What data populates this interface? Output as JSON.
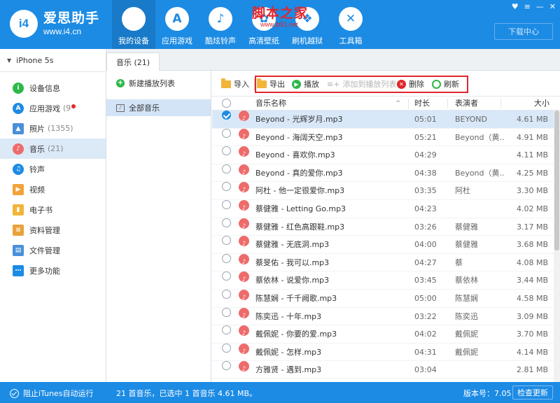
{
  "app": {
    "name": "爱思助手",
    "url": "www.i4.cn",
    "logo_text": "i4"
  },
  "watermark": {
    "text": "脚本之家",
    "url": "www.jb51.net"
  },
  "nav": [
    {
      "label": "我的设备",
      "icon": "apple-icon",
      "glyph": ""
    },
    {
      "label": "应用游戏",
      "icon": "app-store-icon",
      "glyph": "A"
    },
    {
      "label": "酷炫铃声",
      "icon": "bell-icon",
      "glyph": "♪"
    },
    {
      "label": "高清壁纸",
      "icon": "wallpaper-icon",
      "glyph": "✿"
    },
    {
      "label": "刷机越狱",
      "icon": "dropbox-icon",
      "glyph": "❖"
    },
    {
      "label": "工具箱",
      "icon": "tools-icon",
      "glyph": "✕"
    }
  ],
  "window_controls": [
    "♥",
    "≡",
    "—",
    "✕"
  ],
  "download_center": "下载中心",
  "device": {
    "name": "iPhone 5s"
  },
  "sidebar": [
    {
      "label": "设备信息",
      "count": "",
      "icon": "info-icon",
      "color": "#2db84a",
      "glyph": "i"
    },
    {
      "label": "应用游戏",
      "count": "(9",
      "icon": "app-icon",
      "color": "#1c8be4",
      "glyph": "A",
      "dot": true
    },
    {
      "label": "照片",
      "count": "(1355)",
      "icon": "photo-icon",
      "color": "#4a90d9",
      "glyph": "▲"
    },
    {
      "label": "音乐",
      "count": "(21)",
      "icon": "music-icon",
      "color": "#ee6b6b",
      "glyph": "♪"
    },
    {
      "label": "铃声",
      "count": "",
      "icon": "bell-icon",
      "color": "#1c8be4",
      "glyph": "♫"
    },
    {
      "label": "视频",
      "count": "",
      "icon": "video-icon",
      "color": "#f2a33a",
      "glyph": "▶"
    },
    {
      "label": "电子书",
      "count": "",
      "icon": "book-icon",
      "color": "#f2b53a",
      "glyph": "▮"
    },
    {
      "label": "资料管理",
      "count": "",
      "icon": "contacts-icon",
      "color": "#e8a33a",
      "glyph": "≡"
    },
    {
      "label": "文件管理",
      "count": "",
      "icon": "file-icon",
      "color": "#4a90d9",
      "glyph": "▤"
    },
    {
      "label": "更多功能",
      "count": "",
      "icon": "more-icon",
      "color": "#1c8be4",
      "glyph": "⋯"
    }
  ],
  "tab": {
    "label": "音乐 (21)"
  },
  "playlists": {
    "new_label": "新建播放列表",
    "items": [
      {
        "label": "全部音乐"
      }
    ]
  },
  "toolbar": {
    "import": "导入",
    "export": "导出",
    "play": "播放",
    "add_to_playlist": "添加到播放列表",
    "delete": "删除",
    "refresh": "刷新"
  },
  "table": {
    "columns": {
      "name": "音乐名称",
      "duration": "时长",
      "artist": "表演者",
      "size": "大小"
    },
    "rows": [
      {
        "name": "Beyond - 光辉岁月.mp3",
        "duration": "05:01",
        "artist": "BEYOND",
        "size": "4.61 MB",
        "checked": true
      },
      {
        "name": "Beyond - 海阔天空.mp3",
        "duration": "05:21",
        "artist": "Beyond（黄...",
        "size": "4.91 MB",
        "checked": false
      },
      {
        "name": "Beyond - 喜欢你.mp3",
        "duration": "04:29",
        "artist": "",
        "size": "4.11 MB",
        "checked": false
      },
      {
        "name": "Beyond - 真的爱你.mp3",
        "duration": "04:38",
        "artist": "Beyond（黄...",
        "size": "4.25 MB",
        "checked": false
      },
      {
        "name": "阿杜 - 他一定很爱你.mp3",
        "duration": "03:35",
        "artist": "阿杜",
        "size": "3.30 MB",
        "checked": false
      },
      {
        "name": "蔡健雅 - Letting Go.mp3",
        "duration": "04:23",
        "artist": "",
        "size": "4.02 MB",
        "checked": false
      },
      {
        "name": "蔡健雅 - 红色高跟鞋.mp3",
        "duration": "03:26",
        "artist": "蔡健雅",
        "size": "3.17 MB",
        "checked": false
      },
      {
        "name": "蔡健雅 - 无底洞.mp3",
        "duration": "04:00",
        "artist": "蔡健雅",
        "size": "3.68 MB",
        "checked": false
      },
      {
        "name": "蔡旻佑 - 我可以.mp3",
        "duration": "04:27",
        "artist": "蔡",
        "size": "4.08 MB",
        "checked": false
      },
      {
        "name": "蔡依林 - 说爱你.mp3",
        "duration": "03:45",
        "artist": "蔡依林",
        "size": "3.44 MB",
        "checked": false
      },
      {
        "name": "陈慧娴 - 千千阙歌.mp3",
        "duration": "05:00",
        "artist": "陈慧娴",
        "size": "4.58 MB",
        "checked": false
      },
      {
        "name": "陈奕迅 - 十年.mp3",
        "duration": "03:22",
        "artist": "陈奕迅",
        "size": "3.09 MB",
        "checked": false
      },
      {
        "name": "戴佩妮 - 你要的爱.mp3",
        "duration": "04:02",
        "artist": "戴佩妮",
        "size": "3.70 MB",
        "checked": false
      },
      {
        "name": "戴佩妮 - 怎样.mp3",
        "duration": "04:31",
        "artist": "戴佩妮",
        "size": "4.14 MB",
        "checked": false
      },
      {
        "name": "方雅贤 - 遇到.mp3",
        "duration": "03:04",
        "artist": "",
        "size": "2.81 MB",
        "checked": false
      }
    ]
  },
  "status": {
    "itunes": "阻止iTunes自动运行",
    "summary": "21 首音乐，已选中 1 首音乐 4.61 MB。",
    "version": "版本号：7.05",
    "update": "检查更新"
  },
  "colors": {
    "primary": "#1c8be4",
    "highlight_box": "#e0262c",
    "music_icon": "#ee6b6b",
    "selected_row": "#d9e8f8"
  }
}
